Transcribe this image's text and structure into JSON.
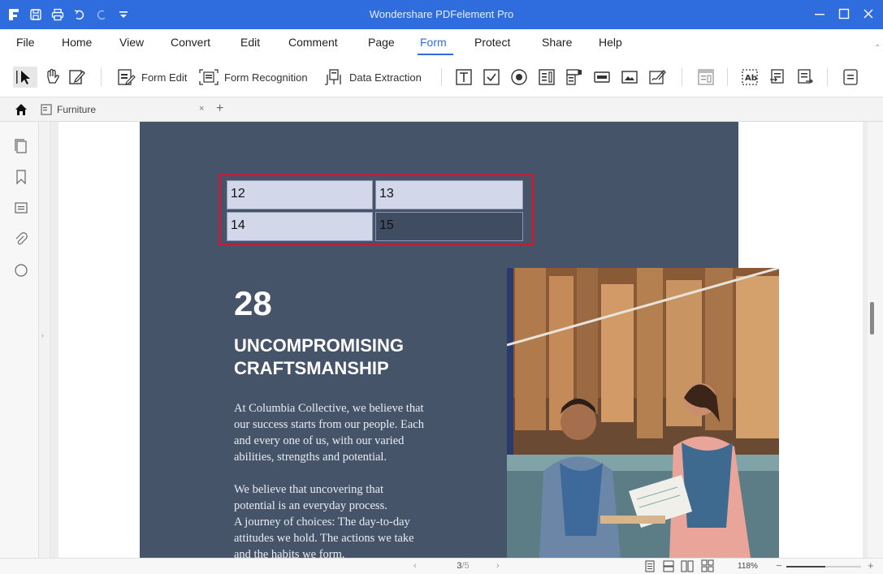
{
  "app": {
    "title": "Wondershare PDFelement Pro"
  },
  "menu": {
    "items": [
      {
        "label": "File"
      },
      {
        "label": "Home"
      },
      {
        "label": "View"
      },
      {
        "label": "Convert"
      },
      {
        "label": "Edit"
      },
      {
        "label": "Comment"
      },
      {
        "label": "Page"
      },
      {
        "label": "Form"
      },
      {
        "label": "Protect"
      },
      {
        "label": "Share"
      },
      {
        "label": "Help"
      }
    ],
    "active": "Form"
  },
  "ribbon": {
    "form_edit": "Form Edit",
    "form_recognition": "Form Recognition",
    "data_extraction": "Data Extraction"
  },
  "tabs": [
    {
      "label": "Furniture"
    }
  ],
  "document": {
    "fields": [
      {
        "value": "12"
      },
      {
        "value": "13"
      },
      {
        "value": "14"
      },
      {
        "value": "15"
      }
    ],
    "number": "28",
    "heading_line1": "UNCOMPROMISING",
    "heading_line2": "CRAFTSMANSHIP",
    "para1": [
      "At Columbia Collective, we believe that",
      "our success starts from our people. Each",
      "and every one of us, with our varied",
      "abilities, strengths and potential."
    ],
    "para2": [
      "We believe that uncovering that",
      "potential is an everyday process.",
      "A journey of choices: The day-to-day",
      "attitudes we hold. The actions we take",
      "and the habits we form."
    ]
  },
  "status": {
    "page_current": "3",
    "page_total": "/5",
    "zoom": "118%"
  },
  "colors": {
    "accent": "#2f6dde",
    "page_dark": "#46546a",
    "field_highlight": "#d2d7ea",
    "field_border": "#b8233a"
  }
}
